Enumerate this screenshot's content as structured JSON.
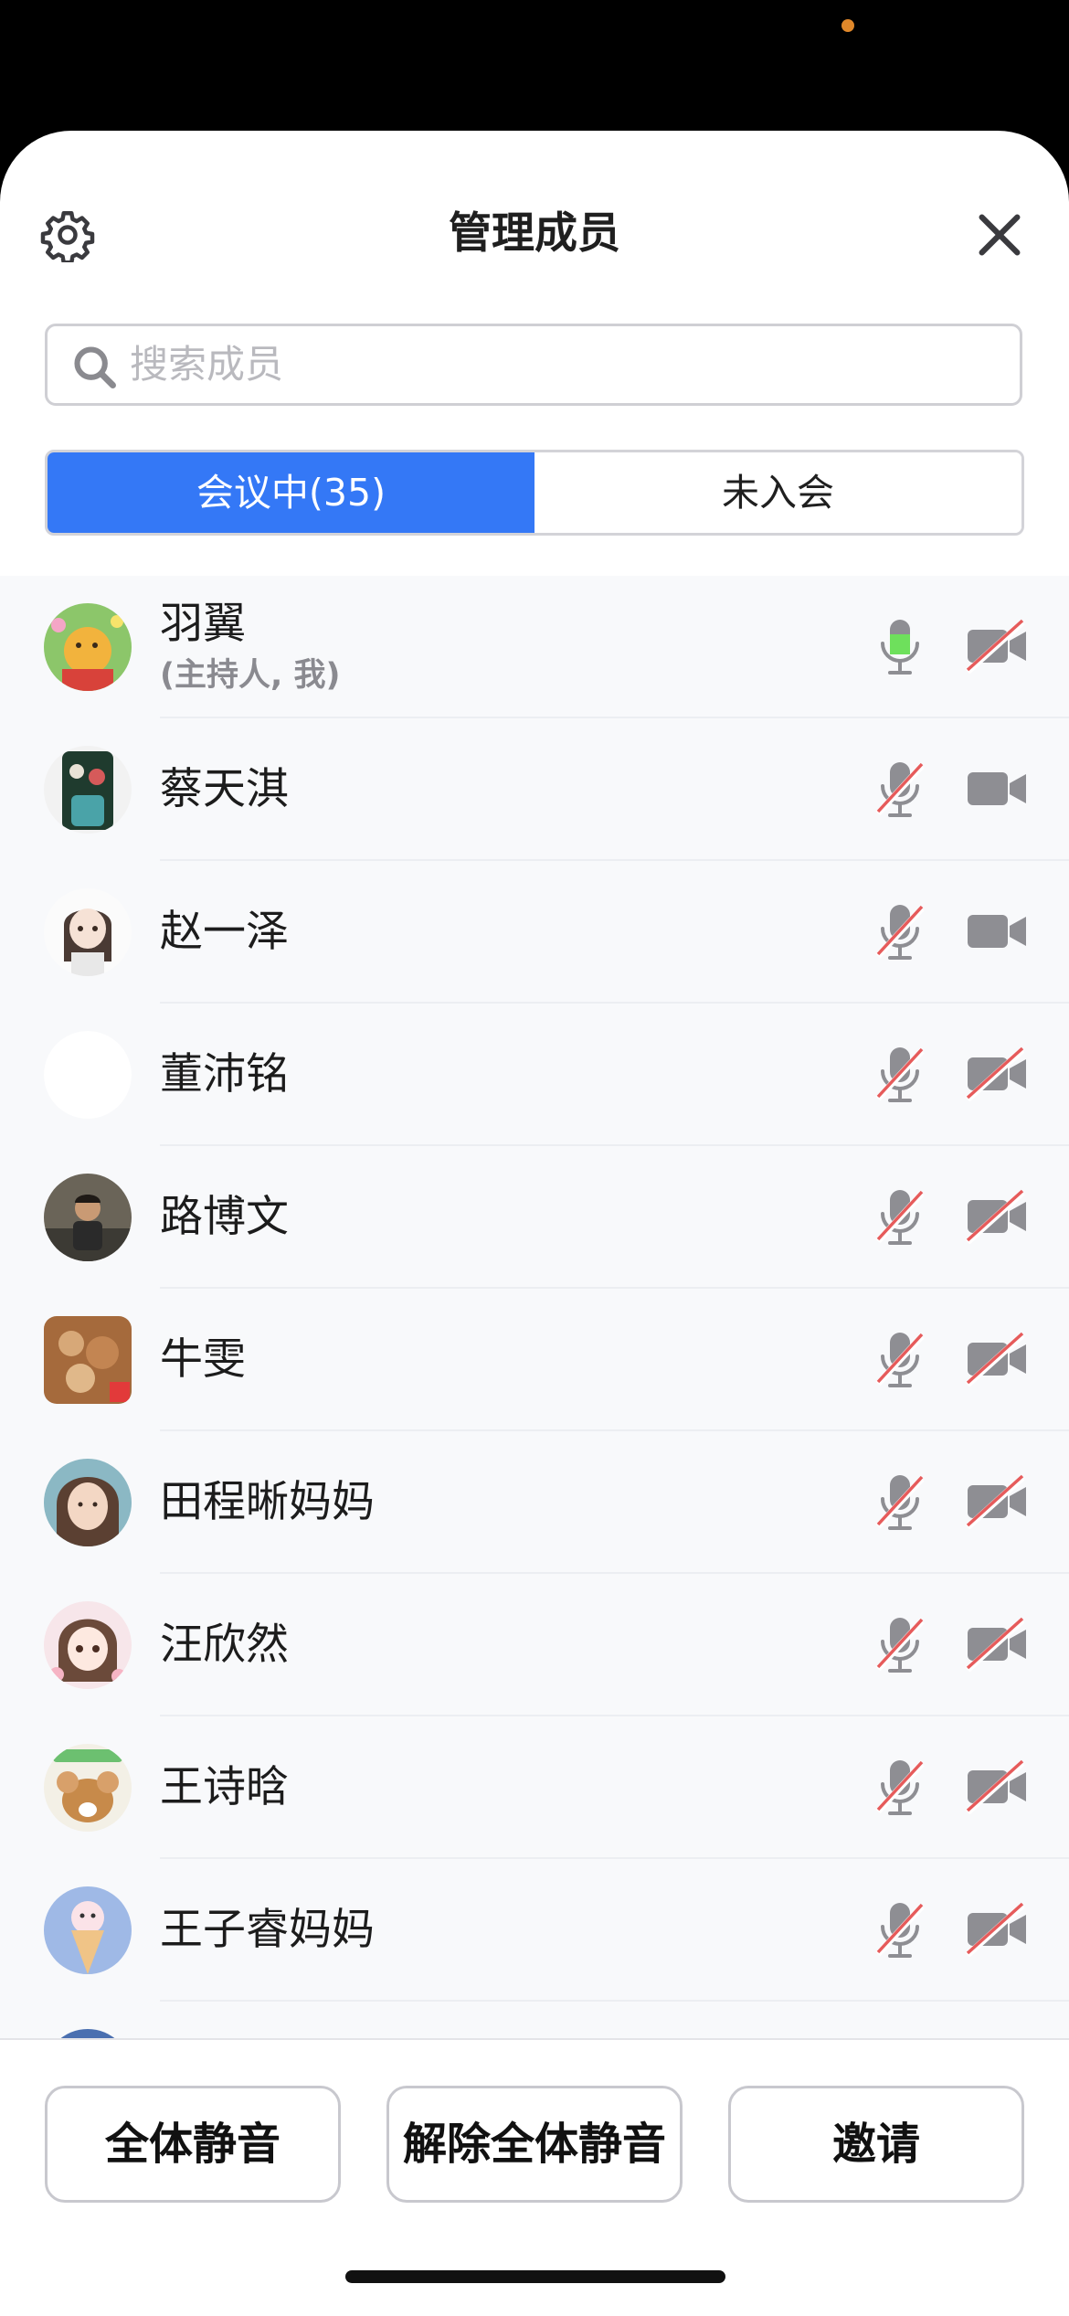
{
  "header": {
    "title": "管理成员"
  },
  "search": {
    "placeholder": "搜索成员"
  },
  "tabs": [
    {
      "label": "会议中(35)",
      "active": true
    },
    {
      "label": "未入会",
      "active": false
    }
  ],
  "members": [
    {
      "name": "羽翼",
      "role": "(主持人, 我)",
      "mic": "on",
      "camera": "off"
    },
    {
      "name": "蔡天淇",
      "mic": "off",
      "camera": "on"
    },
    {
      "name": "赵一泽",
      "mic": "off",
      "camera": "on"
    },
    {
      "name": "董沛铭",
      "mic": "off",
      "camera": "off"
    },
    {
      "name": "路博文",
      "mic": "off",
      "camera": "off"
    },
    {
      "name": "牛雯",
      "mic": "off",
      "camera": "off"
    },
    {
      "name": "田程晰妈妈",
      "mic": "off",
      "camera": "off"
    },
    {
      "name": "汪欣然",
      "mic": "off",
      "camera": "off"
    },
    {
      "name": "王诗晗",
      "mic": "off",
      "camera": "off"
    },
    {
      "name": "王子睿妈妈",
      "mic": "off",
      "camera": "off"
    }
  ],
  "footer": {
    "mute_all": "全体静音",
    "unmute_all": "解除全体静音",
    "invite": "邀请"
  },
  "colors": {
    "accent": "#3478f6",
    "mic_active": "#6ee05c",
    "muted_slash": "#e65b5b",
    "icon_gray": "#8e8e93"
  }
}
